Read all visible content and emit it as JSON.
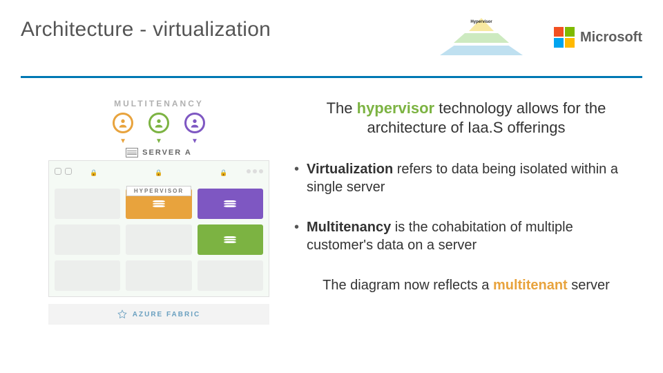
{
  "header": {
    "title": "Architecture - virtualization",
    "pyramid_top": "Hypervisor",
    "brand": "Microsoft"
  },
  "figure": {
    "multitenancy_label": "MULTITENANCY",
    "server_label": "SERVER A",
    "hypervisor_tag": "HYPERVISOR",
    "azure_label": "AZURE FABRIC"
  },
  "content": {
    "lead_pre": "The ",
    "lead_highlight": "hypervisor",
    "lead_post": " technology allows for the architecture of Iaa.S offerings",
    "b1_strong": "Virtualization",
    "b1_rest": " refers to data being isolated within a single server",
    "b2_strong": "Multitenancy",
    "b2_rest": " is the cohabitation of multiple customer's data on a server",
    "closing_pre": "The diagram now reflects a ",
    "closing_highlight": "multitenant",
    "closing_post": " server"
  }
}
